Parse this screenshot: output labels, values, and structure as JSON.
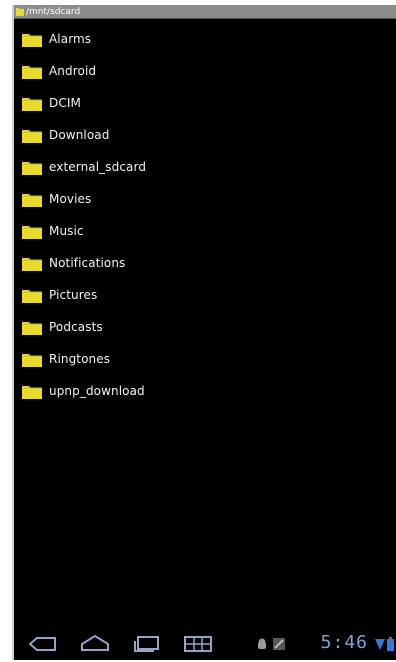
{
  "titlebar": {
    "path": "/mnt/sdcard"
  },
  "folders": [
    {
      "label": "Alarms"
    },
    {
      "label": "Android"
    },
    {
      "label": "DCIM"
    },
    {
      "label": "Download"
    },
    {
      "label": "external_sdcard"
    },
    {
      "label": "Movies"
    },
    {
      "label": "Music"
    },
    {
      "label": "Notifications"
    },
    {
      "label": "Pictures"
    },
    {
      "label": "Podcasts"
    },
    {
      "label": "Ringtones"
    },
    {
      "label": "upnp_download"
    }
  ],
  "statusbar": {
    "time": "5:46"
  },
  "icons": {
    "folder": "folder-icon",
    "back": "back-icon",
    "home": "home-icon",
    "recent": "recent-apps-icon",
    "menu": "menu-grid-icon",
    "android": "android-icon",
    "usb": "usb-icon",
    "wifi": "wifi-icon",
    "battery": "battery-icon"
  },
  "colors": {
    "background": "#000000",
    "folder": "#e9d92a",
    "nav_icon": "#8fa6c8",
    "clock": "#7fa3d6"
  }
}
